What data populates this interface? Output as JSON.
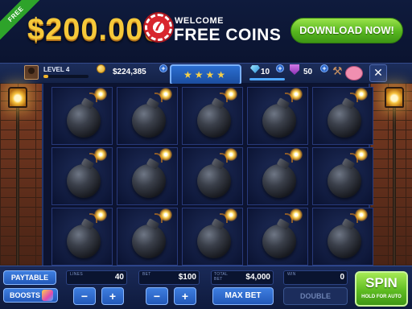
{
  "banner": {
    "ribbon": "FREE",
    "amount": "$200.000",
    "chip_symbol": "7",
    "welcome": "WELCOME",
    "free_coins": "FREE COINS",
    "download": "DOWNLOAD NOW!"
  },
  "hud": {
    "level": "LEVEL 4",
    "level_progress": 0.1,
    "coins": "$224,385",
    "stars": "★★★★",
    "gems": "10",
    "shields": "50",
    "close": "✕"
  },
  "reels": {
    "rows": 3,
    "cols": 5,
    "symbol": "bomb-icon"
  },
  "controls": {
    "paytable": "PAYTABLE",
    "boosts": "BOOSTS",
    "lines_label": "LINES",
    "lines_value": "40",
    "bet_label": "BET",
    "bet_value": "$100",
    "total_bet_label": "TOTAL BET",
    "total_bet_value": "$4,000",
    "win_label": "WIN",
    "win_value": "0",
    "minus": "−",
    "plus": "+",
    "max_bet": "MAX BET",
    "double": "DOUBLE",
    "spin": "SPIN",
    "spin_sub": "HOLD FOR AUTO"
  },
  "colors": {
    "accent_gold": "#f6c93a",
    "button_blue": "#2258b8",
    "spin_green": "#5fbc22"
  }
}
